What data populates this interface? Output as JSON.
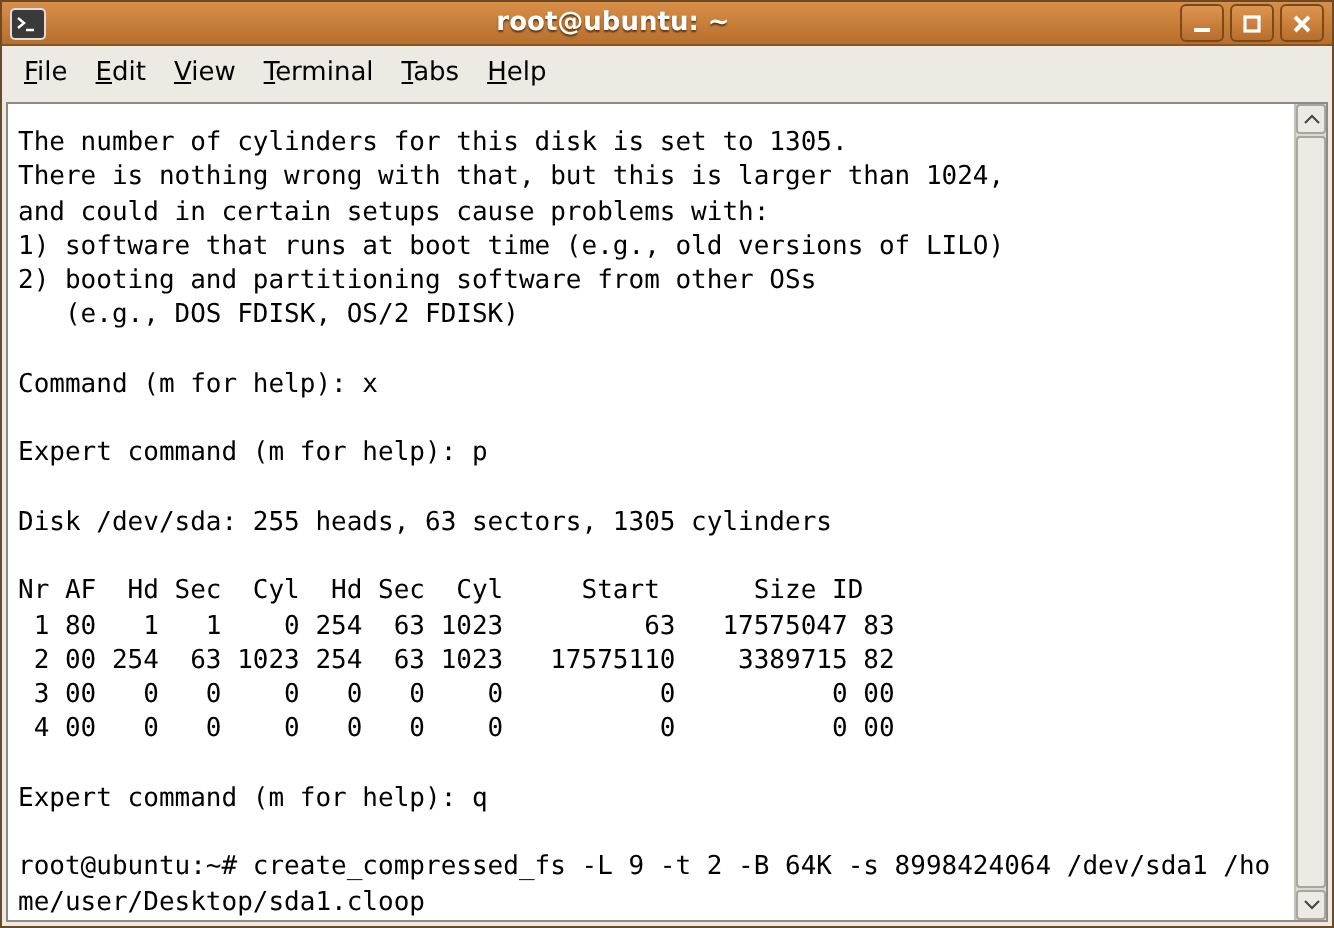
{
  "window": {
    "title": "root@ubuntu: ~"
  },
  "menu": [
    {
      "label": "File"
    },
    {
      "label": "Edit"
    },
    {
      "label": "View"
    },
    {
      "label": "Terminal"
    },
    {
      "label": "Tabs"
    },
    {
      "label": "Help"
    }
  ],
  "terminal": {
    "blocks": [
      [
        "The number of cylinders for this disk is set to 1305.",
        "There is nothing wrong with that, but this is larger than 1024,",
        "and could in certain setups cause problems with:",
        "1) software that runs at boot time (e.g., old versions of LILO)",
        "2) booting and partitioning software from other OSs",
        "   (e.g., DOS FDISK, OS/2 FDISK)"
      ],
      [
        "Command (m for help): x"
      ],
      [
        "Expert command (m for help): p"
      ],
      [
        "Disk /dev/sda: 255 heads, 63 sectors, 1305 cylinders"
      ],
      [
        "Nr AF  Hd Sec  Cyl  Hd Sec  Cyl     Start      Size ID",
        " 1 80   1   1    0 254  63 1023         63   17575047 83",
        " 2 00 254  63 1023 254  63 1023   17575110    3389715 82",
        " 3 00   0   0    0   0   0    0          0          0 00",
        " 4 00   0   0    0   0   0    0          0          0 00"
      ],
      [
        "Expert command (m for help): q"
      ],
      [
        "root@ubuntu:~# create_compressed_fs -L 9 -t 2 -B 64K -s 8998424064 /dev/sda1 /ho",
        "me/user/Desktop/sda1.cloop"
      ]
    ]
  }
}
